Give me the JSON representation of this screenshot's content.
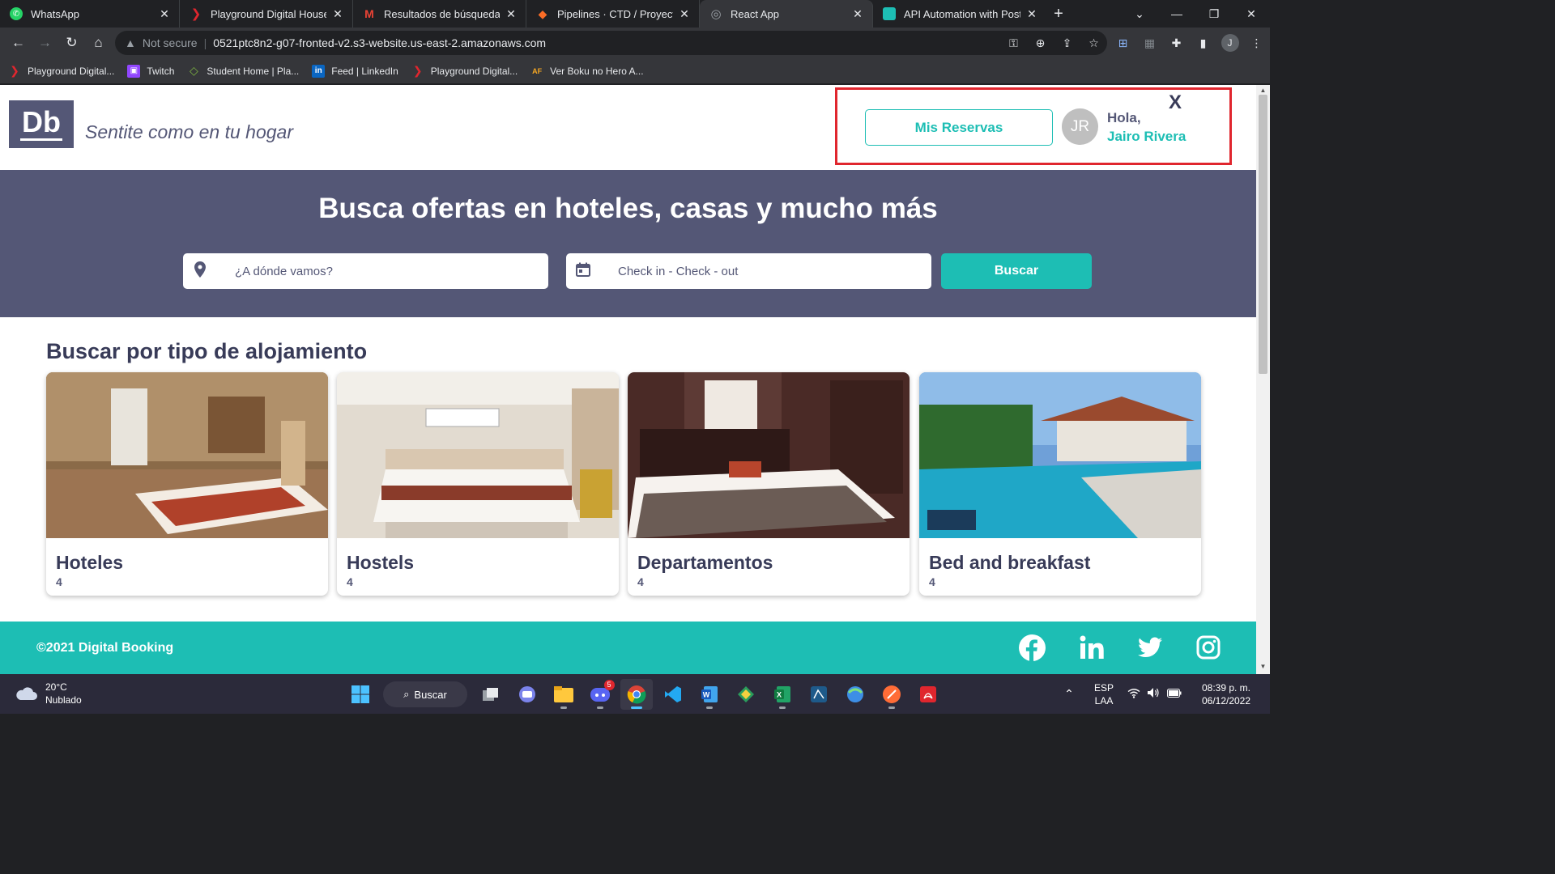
{
  "browser": {
    "tabs": [
      {
        "title": "WhatsApp",
        "fav_color": "#25d366",
        "fav_glyph": "✆"
      },
      {
        "title": "Playground Digital House",
        "fav_color": "#e0262e",
        "fav_glyph": "❯"
      },
      {
        "title": "Resultados de búsqueda - ja",
        "fav_color": "#ea4335",
        "fav_glyph": "M"
      },
      {
        "title": "Pipelines · CTD / Proyecto In",
        "fav_color": "#fc6d26",
        "fav_glyph": "◆"
      },
      {
        "title": "React App",
        "fav_color": "#9aa0a6",
        "fav_glyph": "◎"
      },
      {
        "title": "API Automation with Postm",
        "fav_color": "#1dbeb4",
        "fav_glyph": "▪"
      }
    ],
    "new_tab": "+",
    "url_security": "Not secure",
    "url": "0521ptc8n2-g07-fronted-v2.s3-website.us-east-2.amazonaws.com",
    "profile_initial": "J",
    "bookmarks": [
      {
        "label": "Playground Digital...",
        "fav_color": "#e0262e",
        "fav_glyph": "❯"
      },
      {
        "label": "Twitch",
        "fav_color": "#9146ff",
        "fav_glyph": "▣"
      },
      {
        "label": "Student Home | Pla...",
        "fav_color": "#7cb342",
        "fav_glyph": "◇"
      },
      {
        "label": "Feed | LinkedIn",
        "fav_color": "#0a66c2",
        "fav_glyph": "in"
      },
      {
        "label": "Playground Digital...",
        "fav_color": "#e0262e",
        "fav_glyph": "❯"
      },
      {
        "label": "Ver Boku no Hero A...",
        "fav_color": "#f5a623",
        "fav_glyph": "AF"
      }
    ]
  },
  "site": {
    "logo": "Db",
    "slogan": "Sentite como en tu hogar",
    "my_reservations": "Mis Reservas",
    "avatar_initials": "JR",
    "greeting": "Hola,",
    "user_name": "Jairo Rivera",
    "close": "X",
    "hero_title": "Busca ofertas en hoteles, casas y mucho más",
    "destination_placeholder": "¿A dónde vamos?",
    "dates_placeholder": "Check in - Check - out",
    "search_button": "Buscar",
    "section_title": "Buscar por tipo de alojamiento",
    "categories": [
      {
        "name": "Hoteles",
        "count": "4"
      },
      {
        "name": "Hostels",
        "count": "4"
      },
      {
        "name": "Departamentos",
        "count": "4"
      },
      {
        "name": "Bed and breakfast",
        "count": "4"
      }
    ],
    "footer_copyright": "©2021 Digital Booking",
    "colors": {
      "primary": "#1dbeb4",
      "secondary": "#545776",
      "dark": "#383b58",
      "highlight_border": "#e0262e"
    }
  },
  "taskbar": {
    "temperature": "20°C",
    "weather": "Nublado",
    "search_label": "Buscar",
    "discord_badge": "5",
    "language": "ESP",
    "layout": "LAA",
    "time": "08:39 p. m.",
    "date": "06/12/2022"
  }
}
